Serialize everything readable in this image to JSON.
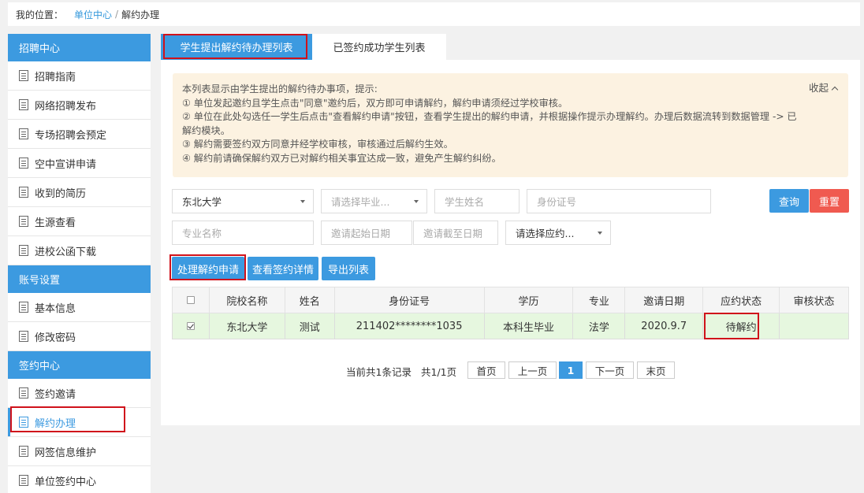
{
  "breadcrumb": {
    "label": "我的位置：",
    "link": "单位中心",
    "sep": "/",
    "current": "解约办理"
  },
  "sidebar": {
    "groups": [
      {
        "header": "招聘中心",
        "items": [
          "招聘指南",
          "网络招聘发布",
          "专场招聘会预定",
          "空中宣讲申请",
          "收到的简历",
          "生源查看",
          "进校公函下载"
        ]
      },
      {
        "header": "账号设置",
        "items": [
          "基本信息",
          "修改密码"
        ]
      },
      {
        "header": "签约中心",
        "items": [
          "签约邀请",
          "解约办理",
          "网签信息维护",
          "单位签约中心"
        ]
      }
    ],
    "active_item": "解约办理"
  },
  "tabs": [
    "学生提出解约待办理列表",
    "已签约成功学生列表"
  ],
  "notice": {
    "collapse_label": "收起",
    "lines": [
      "本列表显示由学生提出的解约待办事项，提示:",
      "① 单位发起邀约且学生点击\"同意\"邀约后，双方即可申请解约，解约申请须经过学校审核。",
      "② 单位在此处勾选任一学生后点击\"查看解约申请\"按钮，查看学生提出的解约申请，并根据操作提示办理解约。办理后数据流转到数据管理 -> 已解约模块。",
      "③ 解约需要签约双方同意并经学校审核，审核通过后解约生效。",
      "④ 解约前请确保解约双方已对解约相关事宜达成一致，避免产生解约纠纷。"
    ]
  },
  "filters": {
    "school": "东北大学",
    "graduation_placeholder": "请选择毕业...",
    "name_placeholder": "学生姓名",
    "id_placeholder": "身份证号",
    "major_placeholder": "专业名称",
    "start_date_placeholder": "邀请起始日期",
    "end_date_placeholder": "邀请截至日期",
    "status_placeholder": "请选择应约..."
  },
  "buttons": {
    "search": "查询",
    "reset": "重置",
    "process": "处理解约申请",
    "view_detail": "查看签约详情",
    "export": "导出列表"
  },
  "table": {
    "headers": [
      "院校名称",
      "姓名",
      "身份证号",
      "学历",
      "专业",
      "邀请日期",
      "应约状态",
      "审核状态"
    ],
    "rows": [
      {
        "checked": true,
        "school": "东北大学",
        "name": "测试",
        "id": "211402********1035",
        "degree": "本科生毕业",
        "major": "法学",
        "date": "2020.9.7",
        "status": "待解约",
        "review": ""
      }
    ]
  },
  "pager": {
    "records": "当前共1条记录",
    "pages": "共1/1页",
    "first": "首页",
    "prev": "上一页",
    "current": "1",
    "next": "下一页",
    "last": "末页"
  },
  "colors": {
    "primary": "#3c9ae0",
    "danger": "#f05a50",
    "highlight": "#d0121b",
    "notice_bg": "#fcf2e1",
    "row_selected": "#e6f7df"
  }
}
